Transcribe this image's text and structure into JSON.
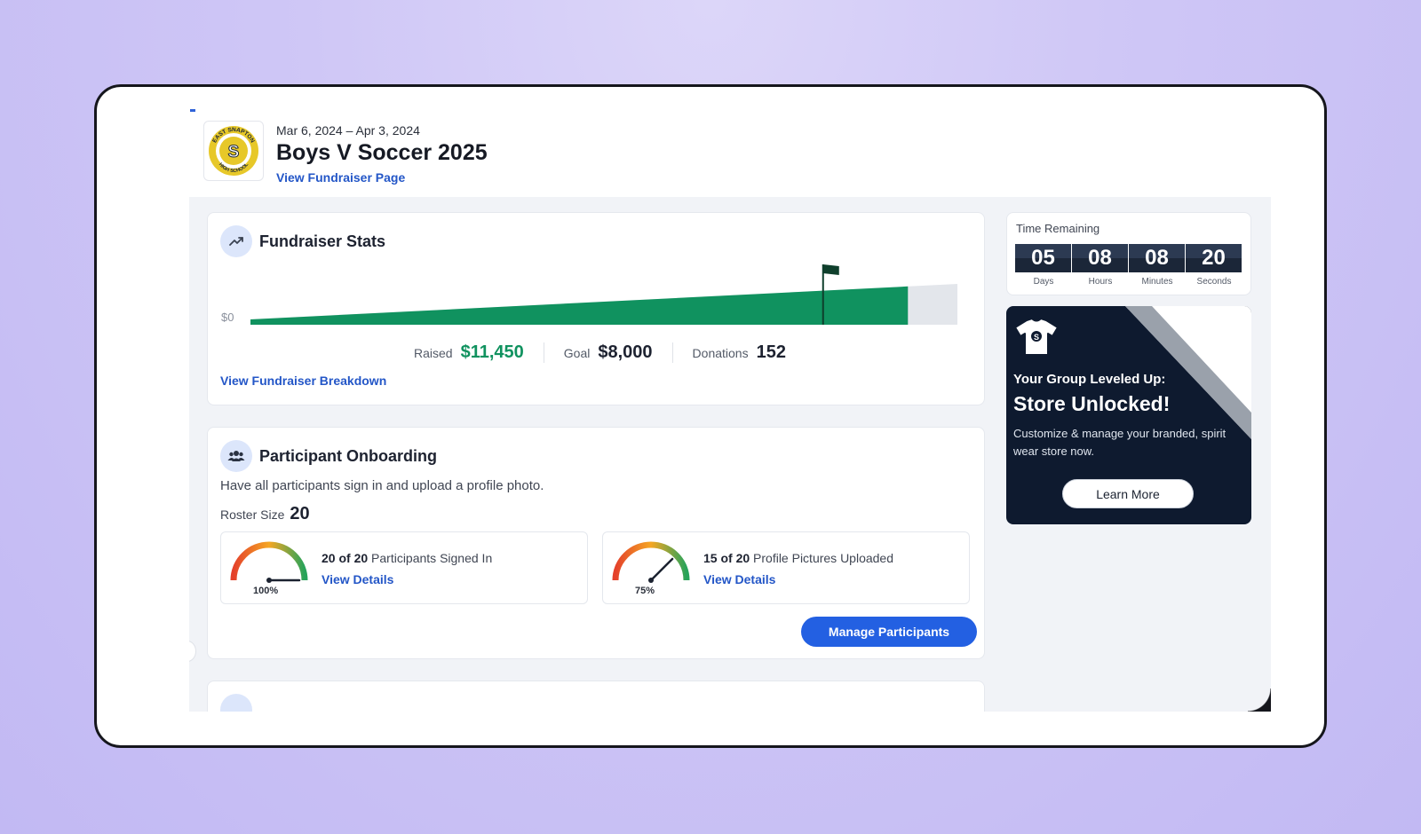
{
  "header": {
    "dates": "Mar 6, 2024 – Apr 3, 2024",
    "title": "Boys V Soccer 2025",
    "view_page_link": "View Fundraiser Page",
    "logo": {
      "name": "school-logo-icon",
      "text_top": "EAST SNAPTON",
      "text_bottom": "HIGH SCHOOL",
      "letter": "S",
      "color": "#e7c829"
    }
  },
  "stats": {
    "title": "Fundraiser Stats",
    "icon": "trending-up-icon",
    "zero_label": "$0",
    "raised_label": "Raised",
    "raised_value": "$11,450",
    "goal_label": "Goal",
    "goal_value": "$8,000",
    "donations_label": "Donations",
    "donations_value": "152",
    "progress_fraction": 0.93,
    "goal_marker_fraction": 0.81,
    "breakdown_link": "View Fundraiser Breakdown",
    "colors": {
      "bar": "#10925f",
      "flag": "#0f3f2c",
      "track": "#e3e6eb"
    }
  },
  "onboarding": {
    "title": "Participant Onboarding",
    "icon": "users-icon",
    "description": "Have all participants sign in and upload a profile photo.",
    "roster_label": "Roster Size",
    "roster_value": "20",
    "gauges": [
      {
        "count": "20 of 20",
        "label": "Participants Signed In",
        "percent_label": "100%",
        "percent": 100,
        "link": "View Details"
      },
      {
        "count": "15 of 20",
        "label": "Profile Pictures Uploaded",
        "percent_label": "75%",
        "percent": 75,
        "link": "View Details"
      }
    ],
    "manage_button": "Manage Participants"
  },
  "timer": {
    "label": "Time Remaining",
    "units": [
      {
        "value": "05",
        "label": "Days"
      },
      {
        "value": "08",
        "label": "Hours"
      },
      {
        "value": "08",
        "label": "Minutes"
      },
      {
        "value": "20",
        "label": "Seconds"
      }
    ]
  },
  "promo": {
    "icon": "tshirt-icon",
    "subtitle": "Your Group Leveled Up:",
    "title": "Store Unlocked!",
    "description": "Customize & manage your branded, spirit wear store now.",
    "button": "Learn More"
  }
}
